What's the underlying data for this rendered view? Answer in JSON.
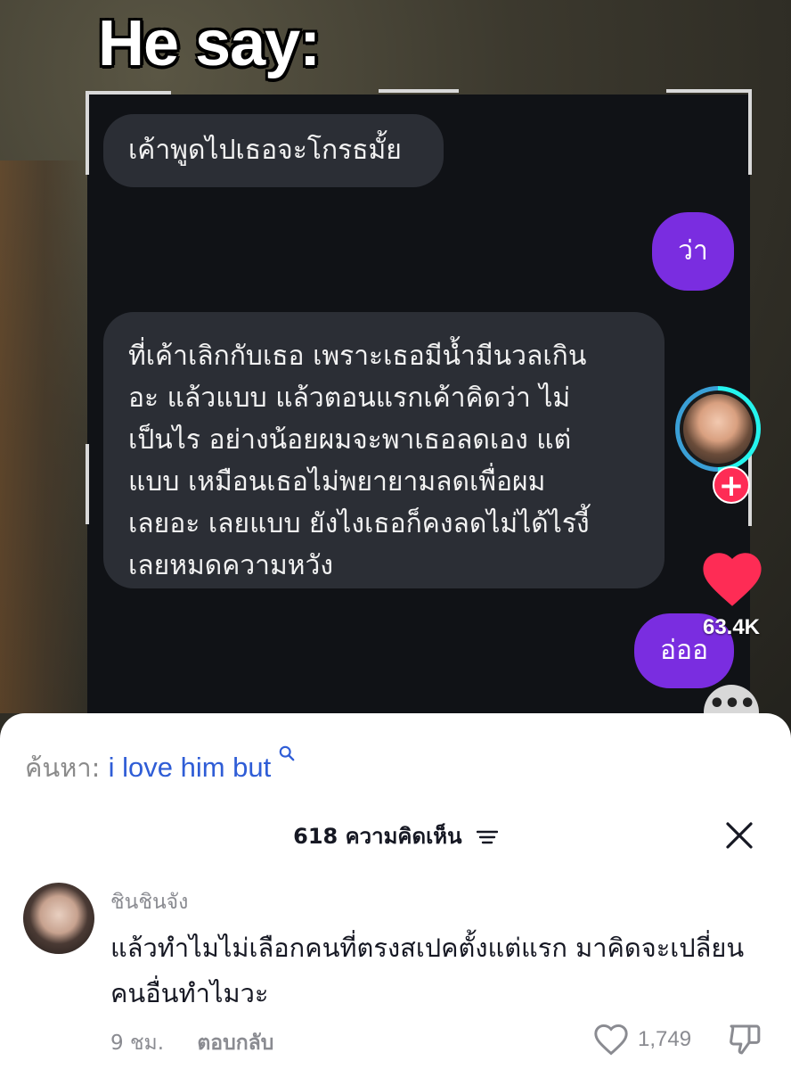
{
  "video": {
    "caption_title": "He say:",
    "messages": [
      {
        "from": "them",
        "text": "เค้าพูดไปเธอจะโกรธมั้ย"
      },
      {
        "from": "me",
        "text": "ว่า"
      },
      {
        "from": "them",
        "text": "ที่เค้าเลิกกับเธอ เพราะเธอมีน้ำมีนวลเกิน\nอะ แล้วแบบ แล้วตอนแรกเค้าคิดว่า ไม่\nเป็นไร อย่างน้อยผมจะพาเธอลดเอง แต่\nแบบ เหมือนเธอไม่พยายามลดเพื่อผม\nเลยอะ เลยแบบ ยังไงเธอก็คงลดไม่ได้ไรงี้\nเลยหมดความหวัง"
      },
      {
        "from": "me",
        "text": "อ่ออ"
      }
    ]
  },
  "side_rail": {
    "like_count": "63.4K",
    "follow_symbol": "+",
    "more_symbol": "•••",
    "icons": [
      "avatar",
      "plus-icon",
      "heart-icon",
      "more-icon"
    ],
    "colors": {
      "like": "#fe2c55",
      "follow": "#fe2c55",
      "ring": "#25f4ee"
    }
  },
  "comments_sheet": {
    "search_prefix": "ค้นหา:",
    "search_term": "i love him but",
    "header": "618 ความคิดเห็น",
    "comments": [
      {
        "username": "ชินชินจัง",
        "text": "แล้วทำไมไม่เลือกคนที่ตรงสเปคตั้งแต่แรก มาคิดจะเปลี่ยนคนอื่นทำไมวะ",
        "time": "9 ชม.",
        "reply_label": "ตอบกลับ",
        "likes": "1,749"
      }
    ],
    "colors": {
      "search_term": "#2f5dd6",
      "text": "#161823",
      "muted": "#8a8b91"
    }
  }
}
